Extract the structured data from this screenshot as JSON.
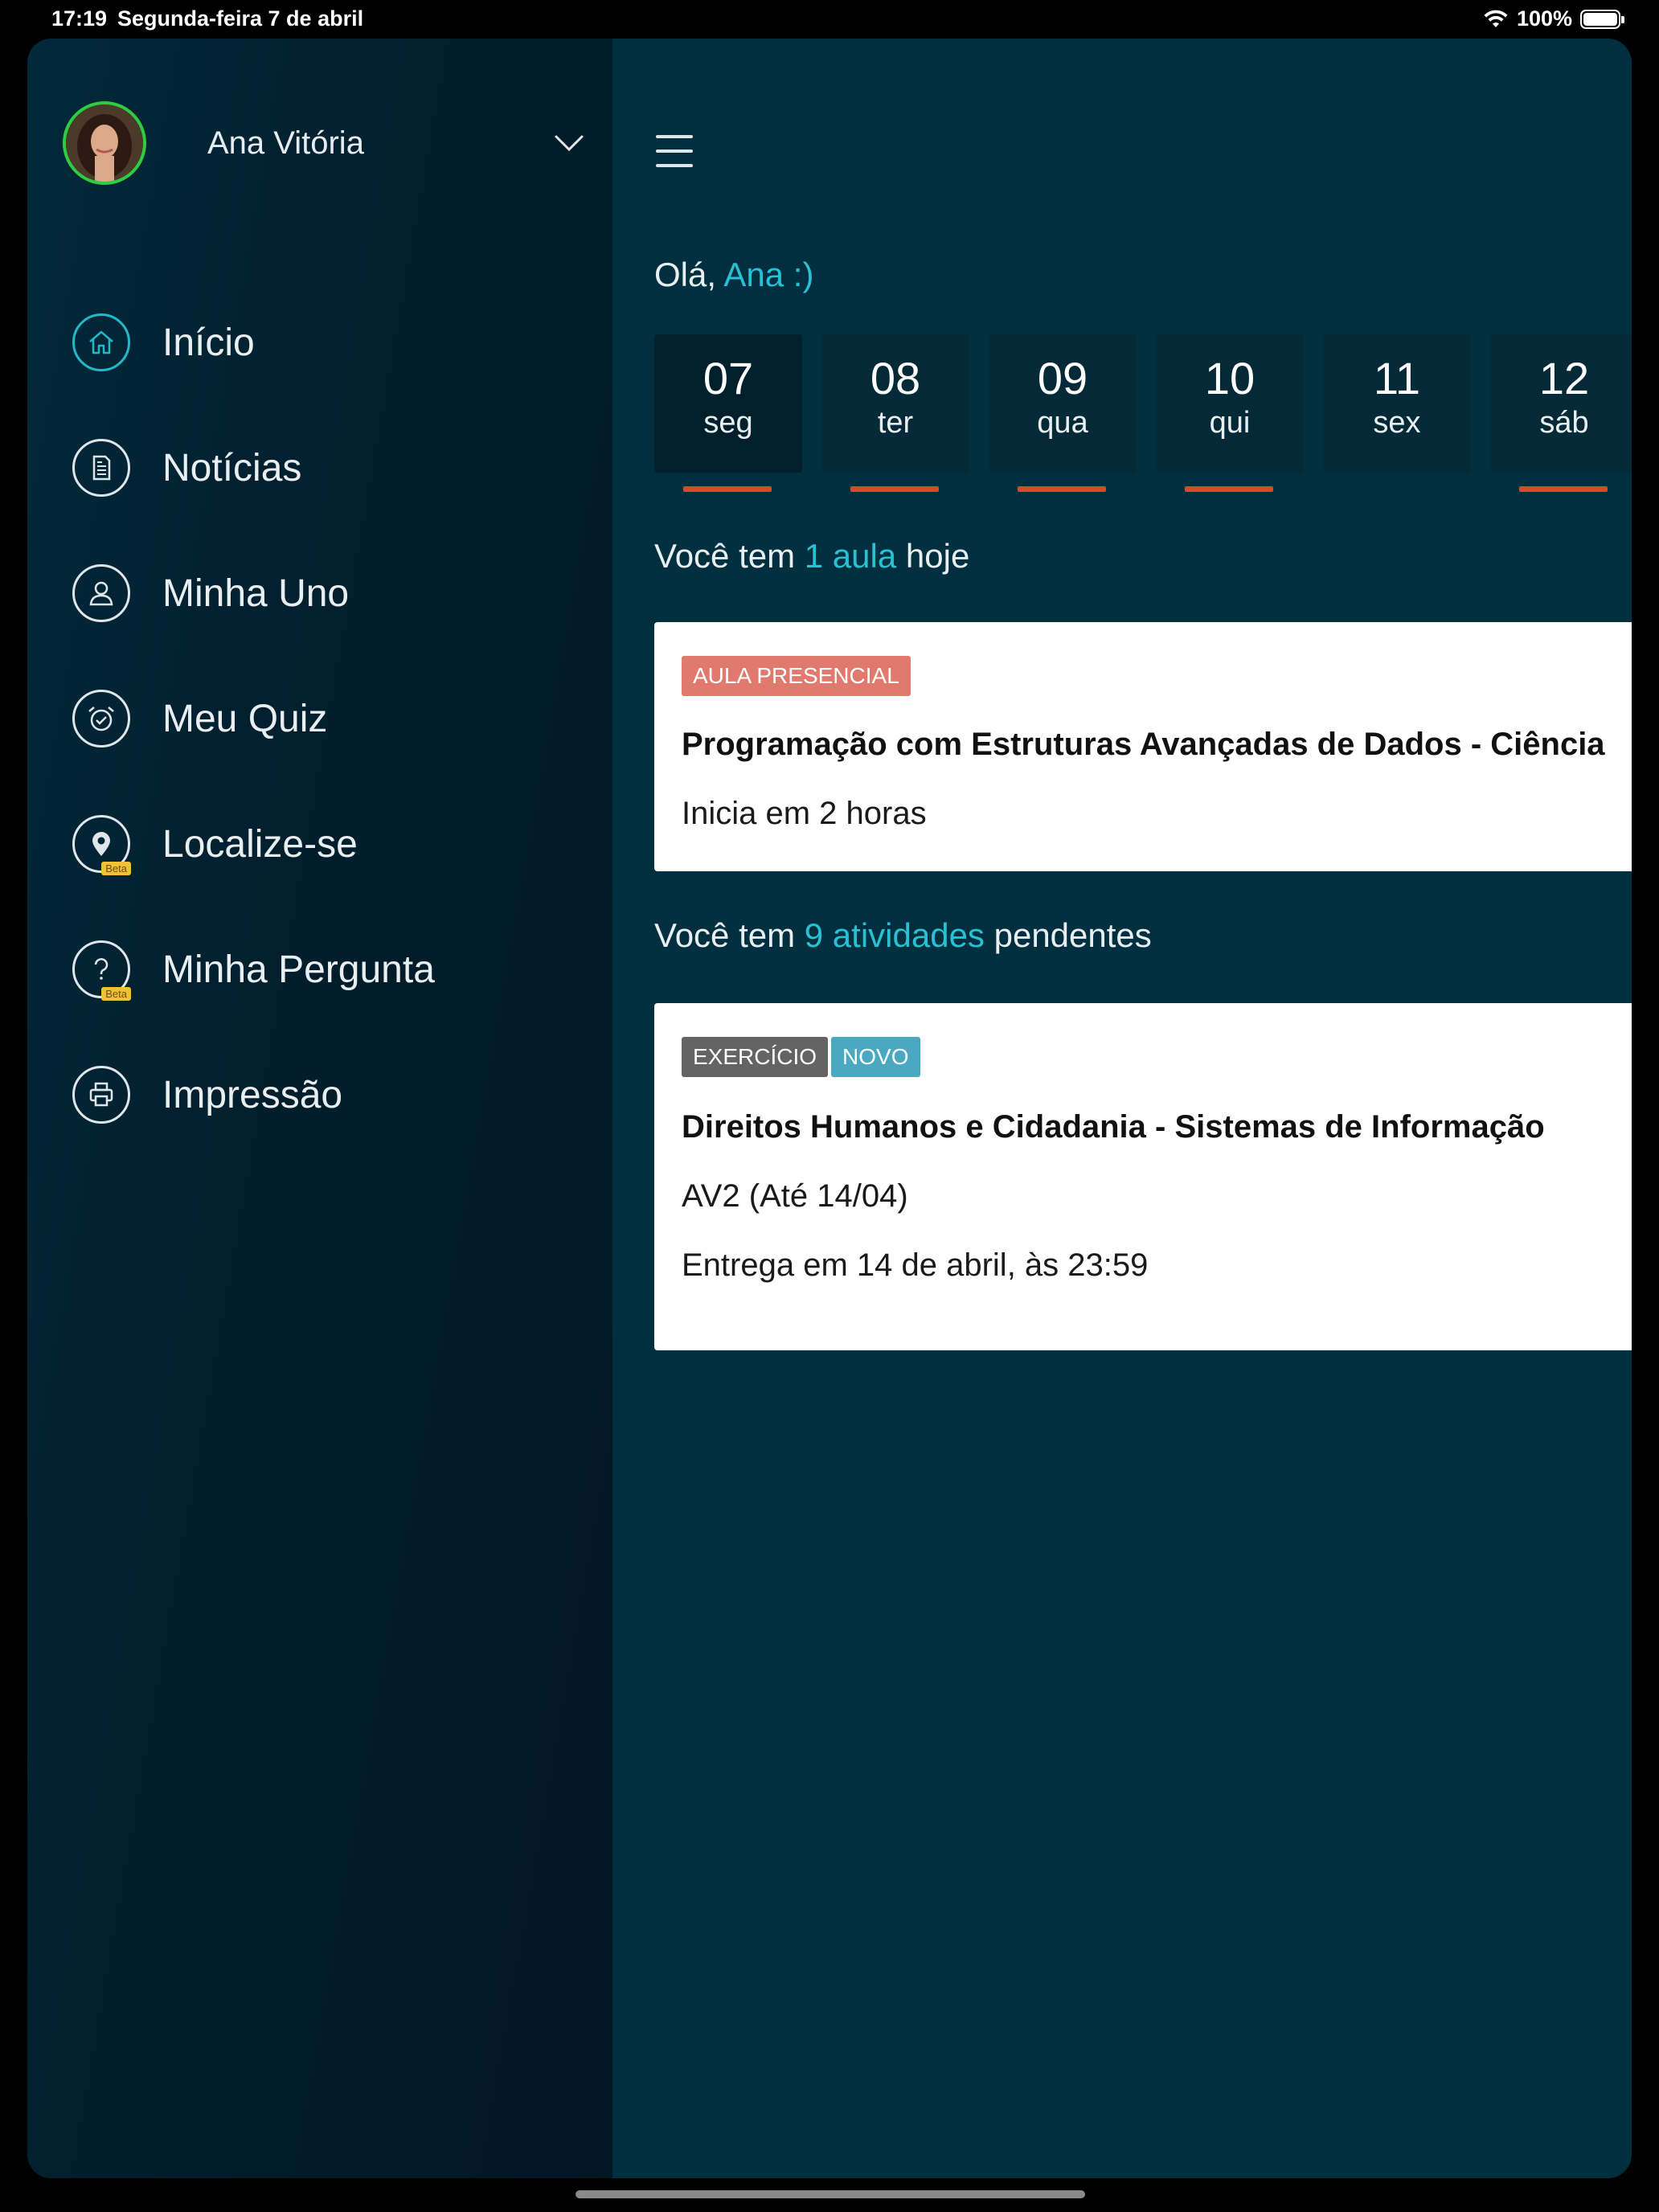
{
  "status_bar": {
    "time": "17:19",
    "date": "Segunda-feira 7 de abril",
    "battery": "100%"
  },
  "sidebar": {
    "user_name": "Ana Vitória",
    "items": [
      {
        "label": "Início",
        "icon": "home-icon",
        "active": true
      },
      {
        "label": "Notícias",
        "icon": "news-icon"
      },
      {
        "label": "Minha Uno",
        "icon": "user-icon"
      },
      {
        "label": "Meu Quiz",
        "icon": "alarm-check-icon"
      },
      {
        "label": "Localize-se",
        "icon": "location-pin-icon",
        "badge": "Beta"
      },
      {
        "label": "Minha Pergunta",
        "icon": "question-icon",
        "badge": "Beta"
      },
      {
        "label": "Impressão",
        "icon": "printer-icon"
      }
    ]
  },
  "main": {
    "greeting_prefix": "Olá,",
    "greeting_name": "Ana :)",
    "days": [
      {
        "num": "07",
        "name": "seg",
        "has_event": true
      },
      {
        "num": "08",
        "name": "ter",
        "has_event": true
      },
      {
        "num": "09",
        "name": "qua",
        "has_event": true
      },
      {
        "num": "10",
        "name": "qui",
        "has_event": true
      },
      {
        "num": "11",
        "name": "sex",
        "has_event": false
      },
      {
        "num": "12",
        "name": "sáb",
        "has_event": true
      }
    ],
    "classes_prefix": "Você tem",
    "classes_count": "1 aula",
    "classes_suffix": "hoje",
    "class_card": {
      "tag": "AULA PRESENCIAL",
      "title": "Programação com Estruturas Avançadas de Dados - Ciência",
      "subtitle": "Inicia em 2 horas"
    },
    "activities_prefix": "Você tem",
    "activities_count": "9 atividades",
    "activities_suffix": "pendentes",
    "activity_card": {
      "tags": [
        "EXERCÍCIO",
        "NOVO"
      ],
      "title": "Direitos Humanos e Cidadania - Sistemas de Informação",
      "subtitle": "AV2 (Até 14/04)",
      "deadline": "Entrega em 14 de abril, às 23:59"
    }
  },
  "colors": {
    "accent": "#27c1d3",
    "event_bar": "#d9482e",
    "tag_presencial": "#e07a6e",
    "tag_exercicio": "#646464",
    "tag_novo": "#4aa8c0",
    "background": "#00303f"
  }
}
